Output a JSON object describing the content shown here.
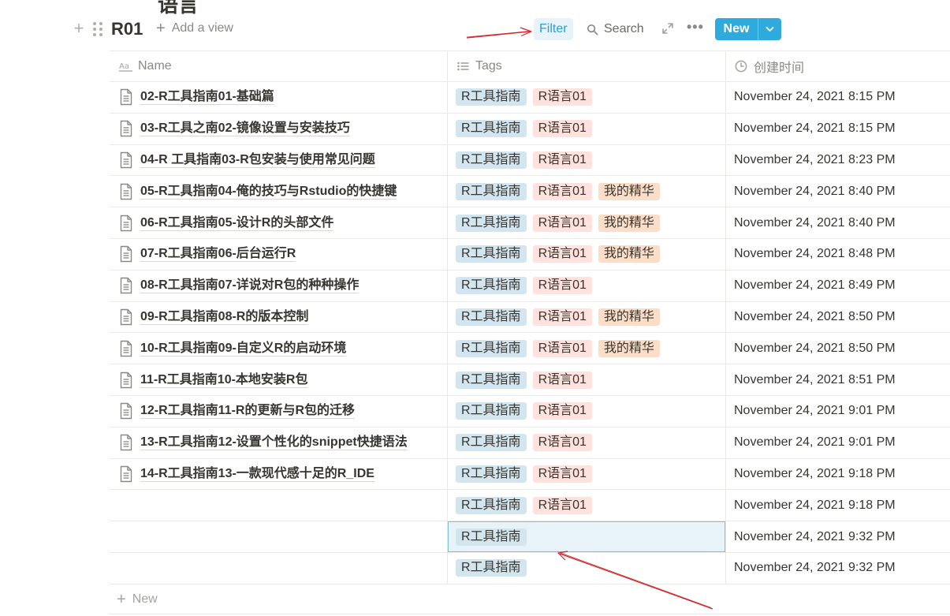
{
  "page": {
    "cut_title": "语言",
    "db_title": "R01",
    "add_view_label": "Add a view"
  },
  "toolbar": {
    "filter_label": "Filter",
    "search_label": "Search",
    "new_label": "New"
  },
  "icons": {
    "add": "plus-icon",
    "drag": "drag-handle-icon",
    "search": "search-icon",
    "expand": "expand-icon",
    "more": "more-icon",
    "dropdown": "chevron-down-icon",
    "name_prop": "text-property-icon",
    "tags_prop": "multi-select-icon",
    "time_prop": "clock-icon",
    "page": "page-icon"
  },
  "colors": {
    "accent": "#2eaadc",
    "filter_bg": "#e7f3f8",
    "tag_blue": "#d3e5ef",
    "tag_red": "#ffe2dd",
    "tag_orange": "#fadec9",
    "annotation_arrow": "#d0282b"
  },
  "table": {
    "columns": [
      {
        "label": "Name",
        "icon": "text-property-icon"
      },
      {
        "label": "Tags",
        "icon": "multi-select-icon"
      },
      {
        "label": "创建时间",
        "icon": "clock-icon"
      }
    ],
    "rows": [
      {
        "name": "02-R工具指南01-基础篇",
        "tags": [
          "R工具指南",
          "R语言01"
        ],
        "time": "November 24, 2021 8:15 PM"
      },
      {
        "name": "03-R工具之南02-镜像设置与安装技巧",
        "tags": [
          "R工具指南",
          "R语言01"
        ],
        "time": "November 24, 2021 8:15 PM"
      },
      {
        "name": "04-R 工具指南03-R包安装与使用常见问题",
        "tags": [
          "R工具指南",
          "R语言01"
        ],
        "time": "November 24, 2021 8:23 PM"
      },
      {
        "name": "05-R工具指南04-俺的技巧与Rstudio的快捷键",
        "tags": [
          "R工具指南",
          "R语言01",
          "我的精华"
        ],
        "time": "November 24, 2021 8:40 PM"
      },
      {
        "name": "06-R工具指南05-设计R的头部文件",
        "tags": [
          "R工具指南",
          "R语言01",
          "我的精华"
        ],
        "time": "November 24, 2021 8:40 PM"
      },
      {
        "name": "07-R工具指南06-后台运行R",
        "tags": [
          "R工具指南",
          "R语言01",
          "我的精华"
        ],
        "time": "November 24, 2021 8:48 PM"
      },
      {
        "name": "08-R工具指南07-详说对R包的种种操作",
        "tags": [
          "R工具指南",
          "R语言01"
        ],
        "time": "November 24, 2021 8:49 PM"
      },
      {
        "name": "09-R工具指南08-R的版本控制",
        "tags": [
          "R工具指南",
          "R语言01",
          "我的精华"
        ],
        "time": "November 24, 2021 8:50 PM"
      },
      {
        "name": "10-R工具指南09-自定义R的启动环境",
        "tags": [
          "R工具指南",
          "R语言01",
          "我的精华"
        ],
        "time": "November 24, 2021 8:50 PM"
      },
      {
        "name": "11-R工具指南10-本地安装R包",
        "tags": [
          "R工具指南",
          "R语言01"
        ],
        "time": "November 24, 2021 8:51 PM"
      },
      {
        "name": "12-R工具指南11-R的更新与R包的迁移",
        "tags": [
          "R工具指南",
          "R语言01"
        ],
        "time": "November 24, 2021 9:01 PM"
      },
      {
        "name": "13-R工具指南12-设置个性化的snippet快捷语法",
        "tags": [
          "R工具指南",
          "R语言01"
        ],
        "time": "November 24, 2021 9:01 PM"
      },
      {
        "name": "14-R工具指南13-一款现代感十足的R_IDE",
        "tags": [
          "R工具指南",
          "R语言01"
        ],
        "time": "November 24, 2021 9:18 PM"
      },
      {
        "name": "",
        "tags": [
          "R工具指南",
          "R语言01"
        ],
        "time": "November 24, 2021 9:18 PM"
      },
      {
        "name": "",
        "tags": [
          "R工具指南"
        ],
        "time": "November 24, 2021 9:32 PM",
        "selected_tags": true
      },
      {
        "name": "",
        "tags": [
          "R工具指南"
        ],
        "time": "November 24, 2021 9:32 PM"
      }
    ],
    "tag_colors": {
      "R工具指南": "blue",
      "R语言01": "red",
      "我的精华": "orange"
    },
    "new_row_label": "New"
  }
}
